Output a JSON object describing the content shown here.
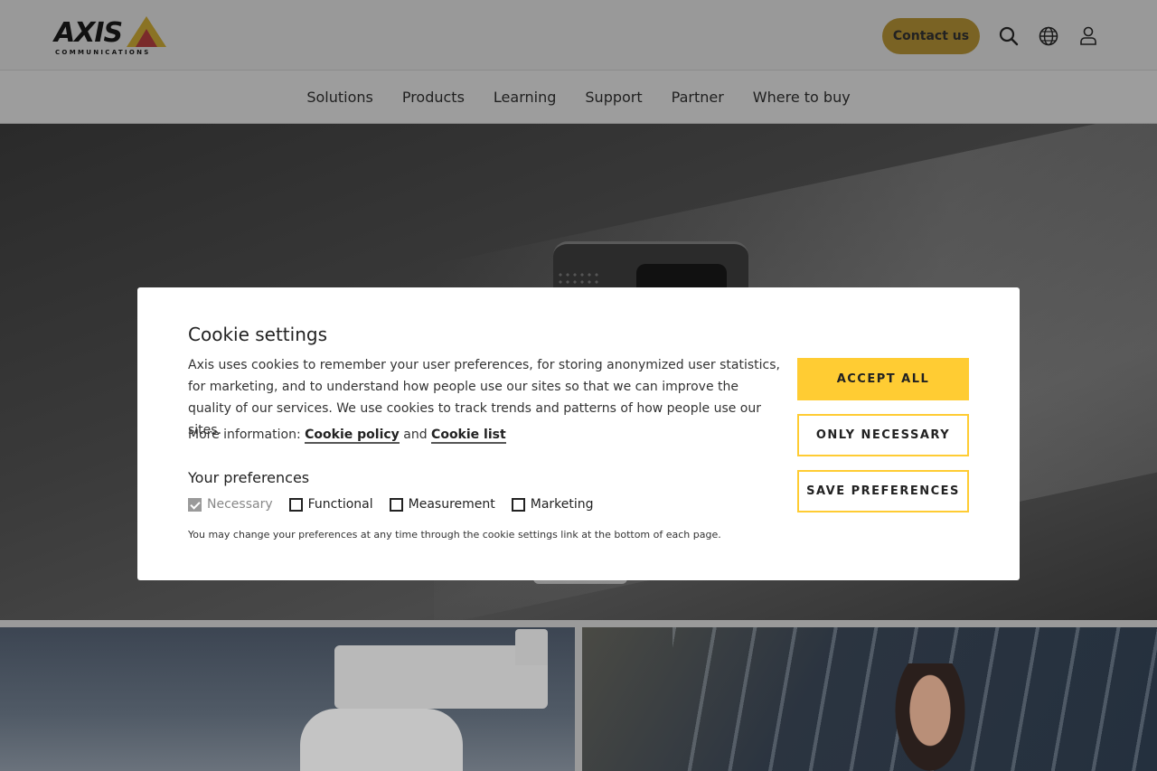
{
  "header": {
    "logo_text": "AXIS",
    "logo_subtext": "COMMUNICATIONS",
    "contact_label": "Contact us"
  },
  "nav": {
    "items": [
      "Solutions",
      "Products",
      "Learning",
      "Support",
      "Partner",
      "Where to buy"
    ]
  },
  "cookie": {
    "title": "Cookie settings",
    "description": "Axis uses cookies to remember your user preferences, for storing anonymized user statistics, for marketing, and to understand how people use our sites so that we can improve the quality of our services. We use cookies to track trends and patterns of how people use our sites.",
    "more_info_prefix": "More information:",
    "cookie_policy_label": "Cookie policy",
    "and_label": "and",
    "cookie_list_label": "Cookie list",
    "preferences_title": "Your preferences",
    "preferences": [
      {
        "label": "Necessary",
        "checked": true,
        "disabled": true
      },
      {
        "label": "Functional",
        "checked": false,
        "disabled": false
      },
      {
        "label": "Measurement",
        "checked": false,
        "disabled": false
      },
      {
        "label": "Marketing",
        "checked": false,
        "disabled": false
      }
    ],
    "note": "You may change your preferences at any time through the cookie settings link at the bottom of each page.",
    "accept_all_label": "ACCEPT ALL",
    "only_necessary_label": "ONLY NECESSARY",
    "save_preferences_label": "SAVE PREFERENCES"
  },
  "colors": {
    "brand_yellow": "#ffcc33",
    "contact_button_dimmed": "#7a6324"
  },
  "icons": [
    "search-icon",
    "globe-icon",
    "user-icon",
    "checkmark-icon"
  ]
}
